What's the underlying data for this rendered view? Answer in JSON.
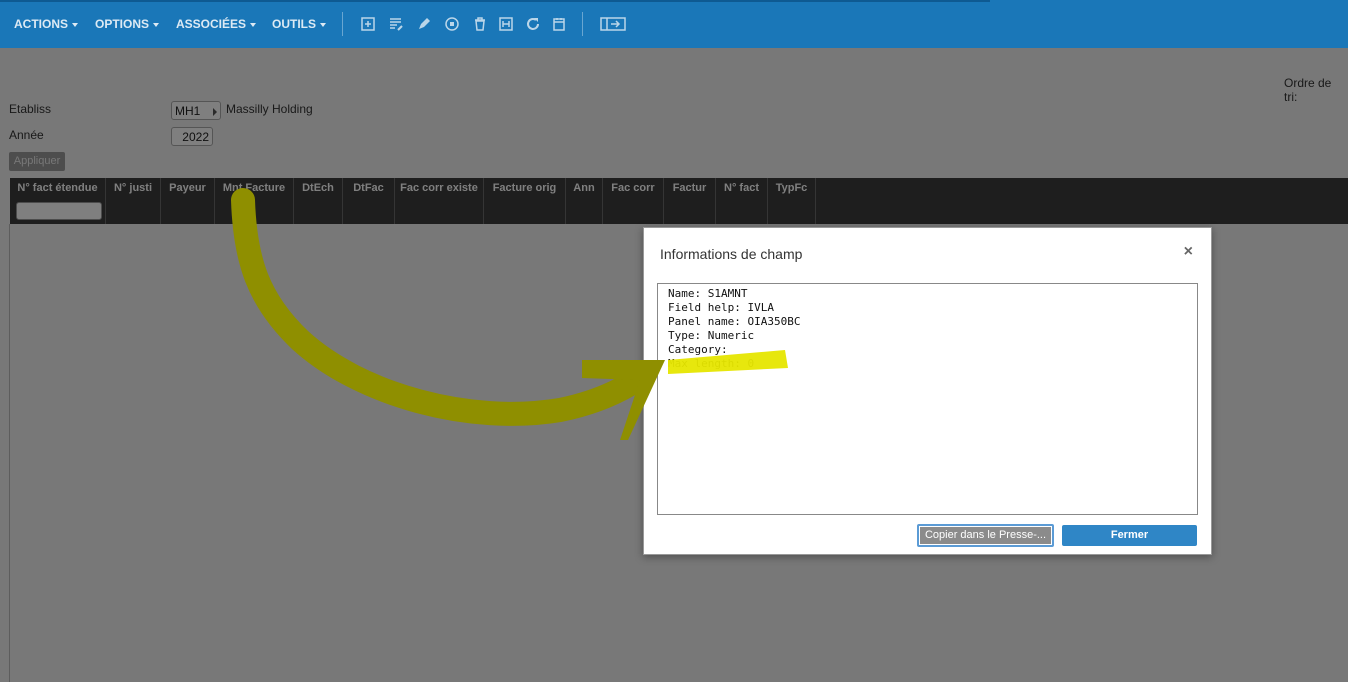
{
  "toolbar": {
    "menus": [
      {
        "label": "ACTIONS"
      },
      {
        "label": "OPTIONS"
      },
      {
        "label": "ASSOCIÉES"
      },
      {
        "label": "OUTILS"
      }
    ],
    "tools": [
      "add-icon",
      "list-edit-icon",
      "pencil-icon",
      "copy-icon",
      "trash-icon",
      "export-icon",
      "refresh-icon",
      "calendar-icon",
      "panel-toggle-icon"
    ],
    "color": "#1a77b8"
  },
  "page": {
    "sort_label": "Ordre de tri:",
    "etabliss_label": "Etabliss",
    "etabliss_value": "MH1",
    "etabliss_desc": "Massilly Holding",
    "annee_label": "Année",
    "annee_value": "2022",
    "apply_label": "Appliquer"
  },
  "grid": {
    "columns": [
      {
        "label": "N° fact étendue"
      },
      {
        "label": "N° justi"
      },
      {
        "label": "Payeur"
      },
      {
        "label": "Mnt Facture"
      },
      {
        "label": "DtEch"
      },
      {
        "label": "DtFac"
      },
      {
        "label": "Fac corr existe"
      },
      {
        "label": "Facture orig"
      },
      {
        "label": "Ann"
      },
      {
        "label": "Fac corr"
      },
      {
        "label": "Factur"
      },
      {
        "label": "N° fact"
      },
      {
        "label": "TypFc"
      }
    ]
  },
  "dialog": {
    "title": "Informations de champ",
    "close_symbol": "×",
    "lines": [
      "Name: S1AMNT",
      "Field help: IVLA",
      "Panel name: OIA350BC",
      "Type: Numeric",
      "Category:",
      "Max length: 0"
    ],
    "copy_label": "Copier dans le Presse-...",
    "close_label": "Fermer"
  },
  "annotation": {
    "highlight_color": "#e6e600"
  }
}
